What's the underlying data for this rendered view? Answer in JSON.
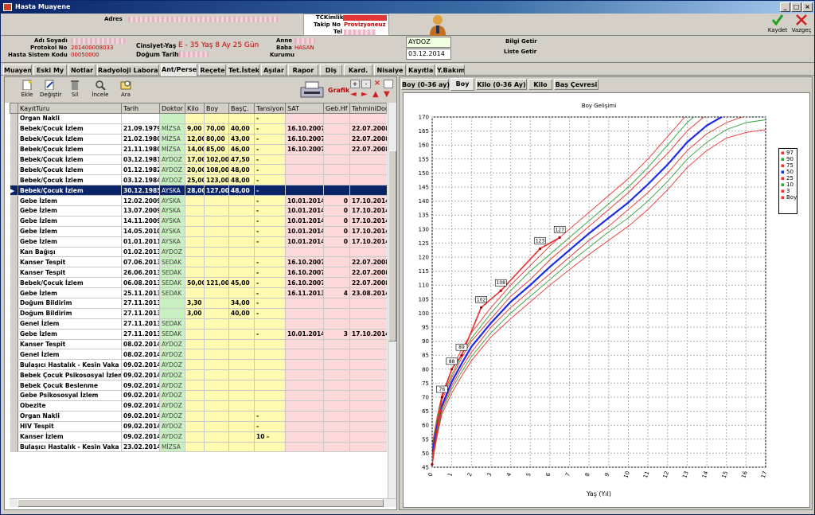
{
  "window": {
    "title": "Hasta Muayene"
  },
  "header": {
    "adres_label": "Adres",
    "tckimlik_label": "TCKimlik",
    "takip_label": "Takip No",
    "takip_value": "Provizyoneuz",
    "tel_label": "Tel",
    "kaydet_label": "Kaydet",
    "vazgec_label": "Vazgeç"
  },
  "patient": {
    "ad_soyad_label": "Adı Soyadı",
    "protokol_label": "Protokol No",
    "protokol_value": "201400008033",
    "sistem_kodu_label": "Hasta Sistem Kodu",
    "sistem_kodu_value": "00050000",
    "cinsiyet_label": "Cinsiyet-Yaş",
    "cinsiyet_value": "E - 35 Yaş 8 Ay 25 Gün",
    "dogum_label": "Doğum Tarihi",
    "anne_label": "Anne",
    "baba_label": "Baba",
    "baba_value": "HASAN",
    "kurum_label": "Kurumu",
    "doktor_value": "AYDOZ",
    "tarih_value": "03.12.2014",
    "bilgi_getir": "Bilgi Getir",
    "liste_getir": "Liste Getir"
  },
  "tabs": [
    "Muayene",
    "Eski My",
    "Notlar",
    "Radyoloji Laboratuvar",
    "Ant/Persentil",
    "Reçete",
    "Tet.İstek",
    "Aşılar",
    "Rapor",
    "Diş",
    "Kard.",
    "Nisaiye",
    "Kayıtlar",
    "Y.Bakım"
  ],
  "toolbar": {
    "ekle": "Ekle",
    "degistir": "Değiştir",
    "sil": "Sil",
    "incele": "İncele",
    "ara": "Ara",
    "grafik": "Grafik"
  },
  "grid": {
    "columns": [
      "KayıtTuru",
      "Tarih",
      "Doktor",
      "Kilo",
      "Boy",
      "BaşÇ.",
      "Tansiyon",
      "SAT",
      "Geb.Hf",
      "TahminiDoğ"
    ],
    "rows": [
      [
        "Organ Nakli",
        "",
        "",
        "",
        "",
        "",
        "-",
        "",
        "",
        ""
      ],
      [
        "Bebek/Çocuk İzlem",
        "21.09.1979",
        "MİZSA",
        "9,00",
        "70,00",
        "40,00",
        "-",
        "16.10.2007",
        "",
        "22.07.2008"
      ],
      [
        "Bebek/Çocuk İzlem",
        "21.02.1980",
        "MİZSA",
        "12,00",
        "80,00",
        "43,00",
        "-",
        "16.10.2007",
        "",
        "22.07.2008"
      ],
      [
        "Bebek/Çocuk İzlem",
        "21.11.1980",
        "MİZSA",
        "14,00",
        "85,00",
        "46,00",
        "-",
        "16.10.2007",
        "",
        "22.07.2008"
      ],
      [
        "Bebek/Çocuk İzlem",
        "03.12.1981",
        "AYDOZ",
        "17,00",
        "102,00",
        "47,50",
        "-",
        "",
        "",
        ""
      ],
      [
        "Bebek/Çocuk İzlem",
        "01.12.1982",
        "AYDOZ",
        "20,00",
        "108,00",
        "48,00",
        "-",
        "",
        "",
        ""
      ],
      [
        "Bebek/Çocuk İzlem",
        "03.12.1984",
        "AYDOZ",
        "25,00",
        "123,00",
        "48,00",
        "-",
        "",
        "",
        ""
      ],
      [
        "Bebek/Çocuk İzlem",
        "30.12.1985",
        "AYSKA",
        "28,00",
        "127,00",
        "48,00",
        "-",
        "",
        "",
        ""
      ],
      [
        "Gebe İzlem",
        "12.02.2009",
        "AYSKA",
        "",
        "",
        "",
        "-",
        "10.01.2014",
        "0",
        "17.10.2014"
      ],
      [
        "Gebe İzlem",
        "13.07.2009",
        "AYSKA",
        "",
        "",
        "",
        "-",
        "10.01.2014",
        "0",
        "17.10.2014"
      ],
      [
        "Gebe İzlem",
        "14.11.2009",
        "AYSKA",
        "",
        "",
        "",
        "-",
        "10.01.2014",
        "0",
        "17.10.2014"
      ],
      [
        "Gebe İzlem",
        "14.05.2010",
        "AYSKA",
        "",
        "",
        "",
        "-",
        "10.01.2014",
        "0",
        "17.10.2014"
      ],
      [
        "Gebe İzlem",
        "01.01.2011",
        "AYSKA",
        "",
        "",
        "",
        "-",
        "10.01.2014",
        "0",
        "17.10.2014"
      ],
      [
        "Kan Bağışı",
        "01.02.2013",
        "AYDOZ",
        "",
        "",
        "",
        "",
        "",
        "",
        ""
      ],
      [
        "Kanser Tespit",
        "07.06.2013",
        "SEDAK",
        "",
        "",
        "",
        "-",
        "16.10.2007",
        "",
        "22.07.2008"
      ],
      [
        "Kanser Tespit",
        "26.06.2013",
        "SEDAK",
        "",
        "",
        "",
        "-",
        "16.10.2007",
        "",
        "22.07.2008"
      ],
      [
        "Bebek/Çocuk İzlem",
        "06.08.2013",
        "SEDAK",
        "50,00",
        "121,00",
        "45,00",
        "-",
        "16.10.2007",
        "",
        "22.07.2008"
      ],
      [
        "Gebe İzlem",
        "25.11.2013",
        "SEDAK",
        "",
        "",
        "",
        "-",
        "16.11.2013",
        "4",
        "23.08.2014"
      ],
      [
        "Doğum Bildirim",
        "27.11.2013",
        "",
        "3,30",
        "",
        "34,00",
        "-",
        "",
        "",
        ""
      ],
      [
        "Doğum Bildirim",
        "27.11.2013",
        "",
        "3,00",
        "",
        "40,00",
        "-",
        "",
        "",
        ""
      ],
      [
        "Genel İzlem",
        "27.11.2013",
        "SEDAK",
        "",
        "",
        "",
        "",
        "",
        "",
        ""
      ],
      [
        "Gebe İzlem",
        "27.11.2013",
        "SEDAK",
        "",
        "",
        "",
        "-",
        "10.01.2014",
        "3",
        "17.10.2014"
      ],
      [
        "Kanser Tespit",
        "08.02.2014",
        "AYDOZ",
        "",
        "",
        "",
        "",
        "",
        "",
        ""
      ],
      [
        "Genel İzlem",
        "08.02.2014",
        "AYDOZ",
        "",
        "",
        "",
        "",
        "",
        "",
        ""
      ],
      [
        "Bulaşıcı Hastalık - Kesin Vaka",
        "09.02.2014",
        "AYDOZ",
        "",
        "",
        "",
        "",
        "",
        "",
        ""
      ],
      [
        "Bebek Çocuk Psikososyal İzlem",
        "09.02.2014",
        "AYDOZ",
        "",
        "",
        "",
        "",
        "",
        "",
        ""
      ],
      [
        "Bebek Çocuk Beslenme",
        "09.02.2014",
        "AYDOZ",
        "",
        "",
        "",
        "",
        "",
        "",
        ""
      ],
      [
        "Gebe Psikososyal İzlem",
        "09.02.2014",
        "AYDOZ",
        "",
        "",
        "",
        "",
        "",
        "",
        ""
      ],
      [
        "Obezite",
        "09.02.2014",
        "AYDOZ",
        "",
        "",
        "",
        "",
        "",
        "",
        ""
      ],
      [
        "Organ Nakli",
        "09.02.2014",
        "AYDOZ",
        "",
        "",
        "",
        "-",
        "",
        "",
        ""
      ],
      [
        "HIV Tespit",
        "09.02.2014",
        "AYDOZ",
        "",
        "",
        "",
        "-",
        "",
        "",
        ""
      ],
      [
        "Kanser İzlem",
        "09.02.2014",
        "AYDOZ",
        "",
        "",
        "",
        "10 -",
        "",
        "",
        ""
      ],
      [
        "Bulaşıcı Hastalık - Kesin Vaka",
        "23.02.2014",
        "MİZSA",
        "",
        "",
        "",
        "",
        "",
        "",
        ""
      ]
    ],
    "current_row": 7
  },
  "right_tabs": [
    "Boy (0-36 ay)",
    "Boy",
    "Kilo (0-36 Ay)",
    "Kilo",
    "Baş Çevresi"
  ],
  "chart_data": {
    "type": "line",
    "title": "Boy Gelişimi",
    "xlabel": "Yaş (Yıl)",
    "ylabel": "",
    "xlim": [
      0,
      17
    ],
    "ylim": [
      45,
      170
    ],
    "xticks": [
      0,
      1,
      2,
      3,
      4,
      5,
      6,
      7,
      8,
      9,
      10,
      11,
      12,
      13,
      14,
      15,
      16,
      17
    ],
    "yticks": [
      45,
      50,
      55,
      60,
      65,
      70,
      75,
      80,
      85,
      90,
      95,
      100,
      105,
      110,
      115,
      120,
      125,
      130,
      135,
      140,
      145,
      150,
      155,
      160,
      165,
      170
    ],
    "grid": true,
    "legend_position": "right",
    "x": [
      0,
      0.25,
      0.5,
      1,
      1.5,
      2,
      3,
      4,
      5,
      6,
      7,
      8,
      9,
      10,
      11,
      12,
      13,
      14,
      15,
      16,
      17
    ],
    "series": [
      {
        "name": "97",
        "color": "#e83030",
        "values": [
          53,
          63,
          71,
          80,
          87,
          93,
          102,
          110,
          117,
          124,
          130,
          136,
          142,
          148,
          155,
          163,
          171,
          177,
          181,
          183,
          184
        ]
      },
      {
        "name": "90",
        "color": "#30a030",
        "values": [
          52,
          62,
          70,
          78,
          85,
          91,
          100,
          108,
          115,
          121,
          127,
          133,
          139,
          145,
          152,
          160,
          168,
          174,
          178,
          180,
          181
        ]
      },
      {
        "name": "75",
        "color": "#e83030",
        "values": [
          51,
          61,
          69,
          77,
          84,
          90,
          98,
          106,
          112,
          119,
          125,
          131,
          137,
          143,
          150,
          157,
          165,
          171,
          175,
          177,
          178
        ]
      },
      {
        "name": "50",
        "color": "#1a2ae8",
        "values": [
          49.5,
          59.5,
          67,
          75.5,
          82,
          88,
          96.5,
          104,
          110,
          116.5,
          122.5,
          128.5,
          134,
          139.5,
          146,
          153,
          161,
          167,
          171,
          173,
          174
        ]
      },
      {
        "name": "25",
        "color": "#e83030",
        "values": [
          48.5,
          58,
          66,
          74,
          80.5,
          86,
          95,
          102,
          108,
          114,
          120,
          126,
          131,
          137,
          143,
          150,
          158,
          164,
          168,
          170.5,
          171
        ]
      },
      {
        "name": "10",
        "color": "#30a030",
        "values": [
          47.5,
          57,
          65,
          73,
          79,
          84.5,
          93,
          100,
          106,
          112,
          118,
          123.5,
          129,
          134,
          140,
          147,
          155,
          161,
          165.5,
          168,
          169
        ]
      },
      {
        "name": "3",
        "color": "#e83030",
        "values": [
          46.5,
          56,
          64,
          71.5,
          77.5,
          83,
          91.5,
          98,
          104,
          110,
          115.5,
          121,
          126,
          131,
          137,
          144,
          152,
          158,
          162.5,
          164.5,
          165.5
        ]
      },
      {
        "name": "Boy",
        "color": "#e83030",
        "x": [
          0,
          0.5,
          1,
          1.5,
          2.5,
          3.5,
          5.5,
          6.5
        ],
        "values": [
          46,
          70,
          80,
          85,
          102,
          108,
          123,
          127
        ],
        "labels": [
          "",
          "76",
          "88",
          "89",
          "102",
          "108",
          "123",
          "127"
        ]
      }
    ]
  }
}
